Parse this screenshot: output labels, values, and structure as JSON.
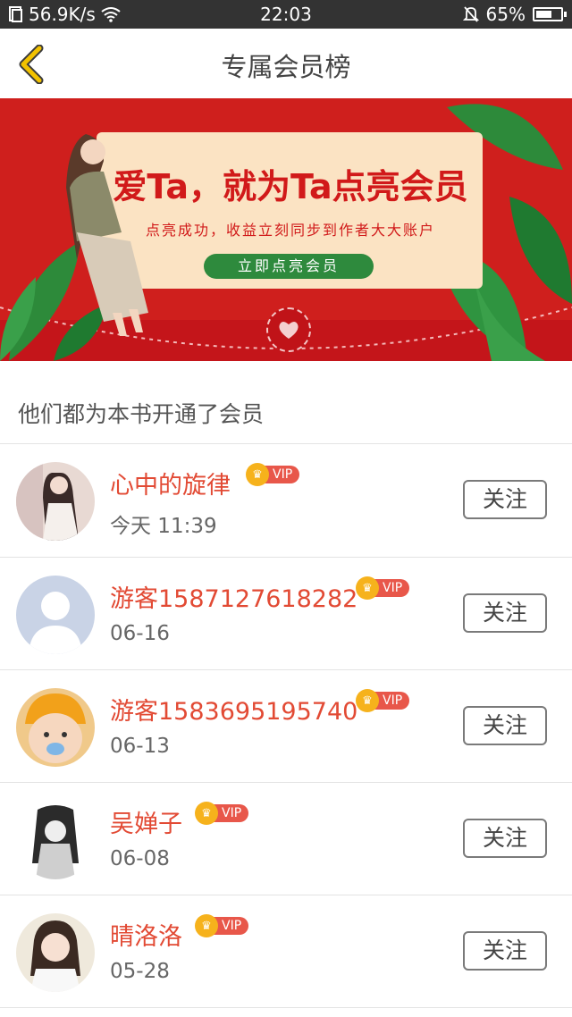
{
  "status_bar": {
    "speed": "56.9K/s",
    "time": "22:03",
    "battery": "65%",
    "battery_level": 0.65
  },
  "nav": {
    "title": "专属会员榜"
  },
  "banner": {
    "headline": "爱Ta，就为Ta点亮会员",
    "subtitle": "点亮成功，收益立刻同步到作者大大账户",
    "cta": "立即点亮会员"
  },
  "section": {
    "title": "他们都为本书开通了会员"
  },
  "vip_label": "VIP",
  "follow_label": "关注",
  "members": [
    {
      "name": "心中的旋律",
      "time": "今天 11:39"
    },
    {
      "name": "游客1587127618282",
      "time": "06-16"
    },
    {
      "name": "游客1583695195740",
      "time": "06-13"
    },
    {
      "name": "吴婵子",
      "time": "06-08"
    },
    {
      "name": "晴洛洛",
      "time": "05-28"
    }
  ],
  "colors": {
    "name_red": "#e24a34",
    "banner_red": "#cf1f1d",
    "cta_green": "#2e8a3d",
    "vip_gold": "#f6b21c",
    "back_yellow": "#f2c200"
  }
}
